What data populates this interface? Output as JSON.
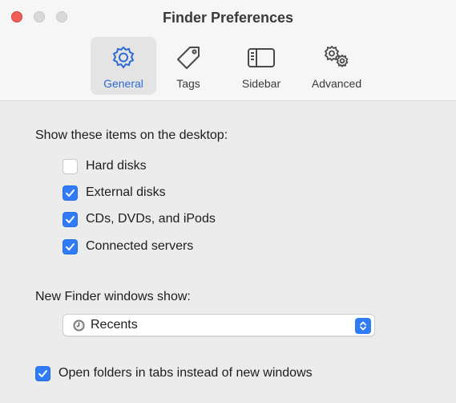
{
  "window": {
    "title": "Finder Preferences"
  },
  "toolbar": {
    "tabs": [
      {
        "label": "General",
        "icon": "gear-icon",
        "selected": true
      },
      {
        "label": "Tags",
        "icon": "tag-icon",
        "selected": false
      },
      {
        "label": "Sidebar",
        "icon": "sidebar-icon",
        "selected": false
      },
      {
        "label": "Advanced",
        "icon": "gears-icon",
        "selected": false
      }
    ]
  },
  "desktop_items": {
    "heading": "Show these items on the desktop:",
    "options": [
      {
        "label": "Hard disks",
        "checked": false
      },
      {
        "label": "External disks",
        "checked": true
      },
      {
        "label": "CDs, DVDs, and iPods",
        "checked": true
      },
      {
        "label": "Connected servers",
        "checked": true
      }
    ]
  },
  "new_windows": {
    "heading": "New Finder windows show:",
    "selected_value": "Recents",
    "selected_icon": "clock-icon"
  },
  "tabs_option": {
    "label": "Open folders in tabs instead of new windows",
    "checked": true
  },
  "colors": {
    "accent": "#2f7cf6",
    "close": "#ec5e56",
    "window_bg": "#ececec",
    "titlebar_bg": "#f6f6f6"
  }
}
